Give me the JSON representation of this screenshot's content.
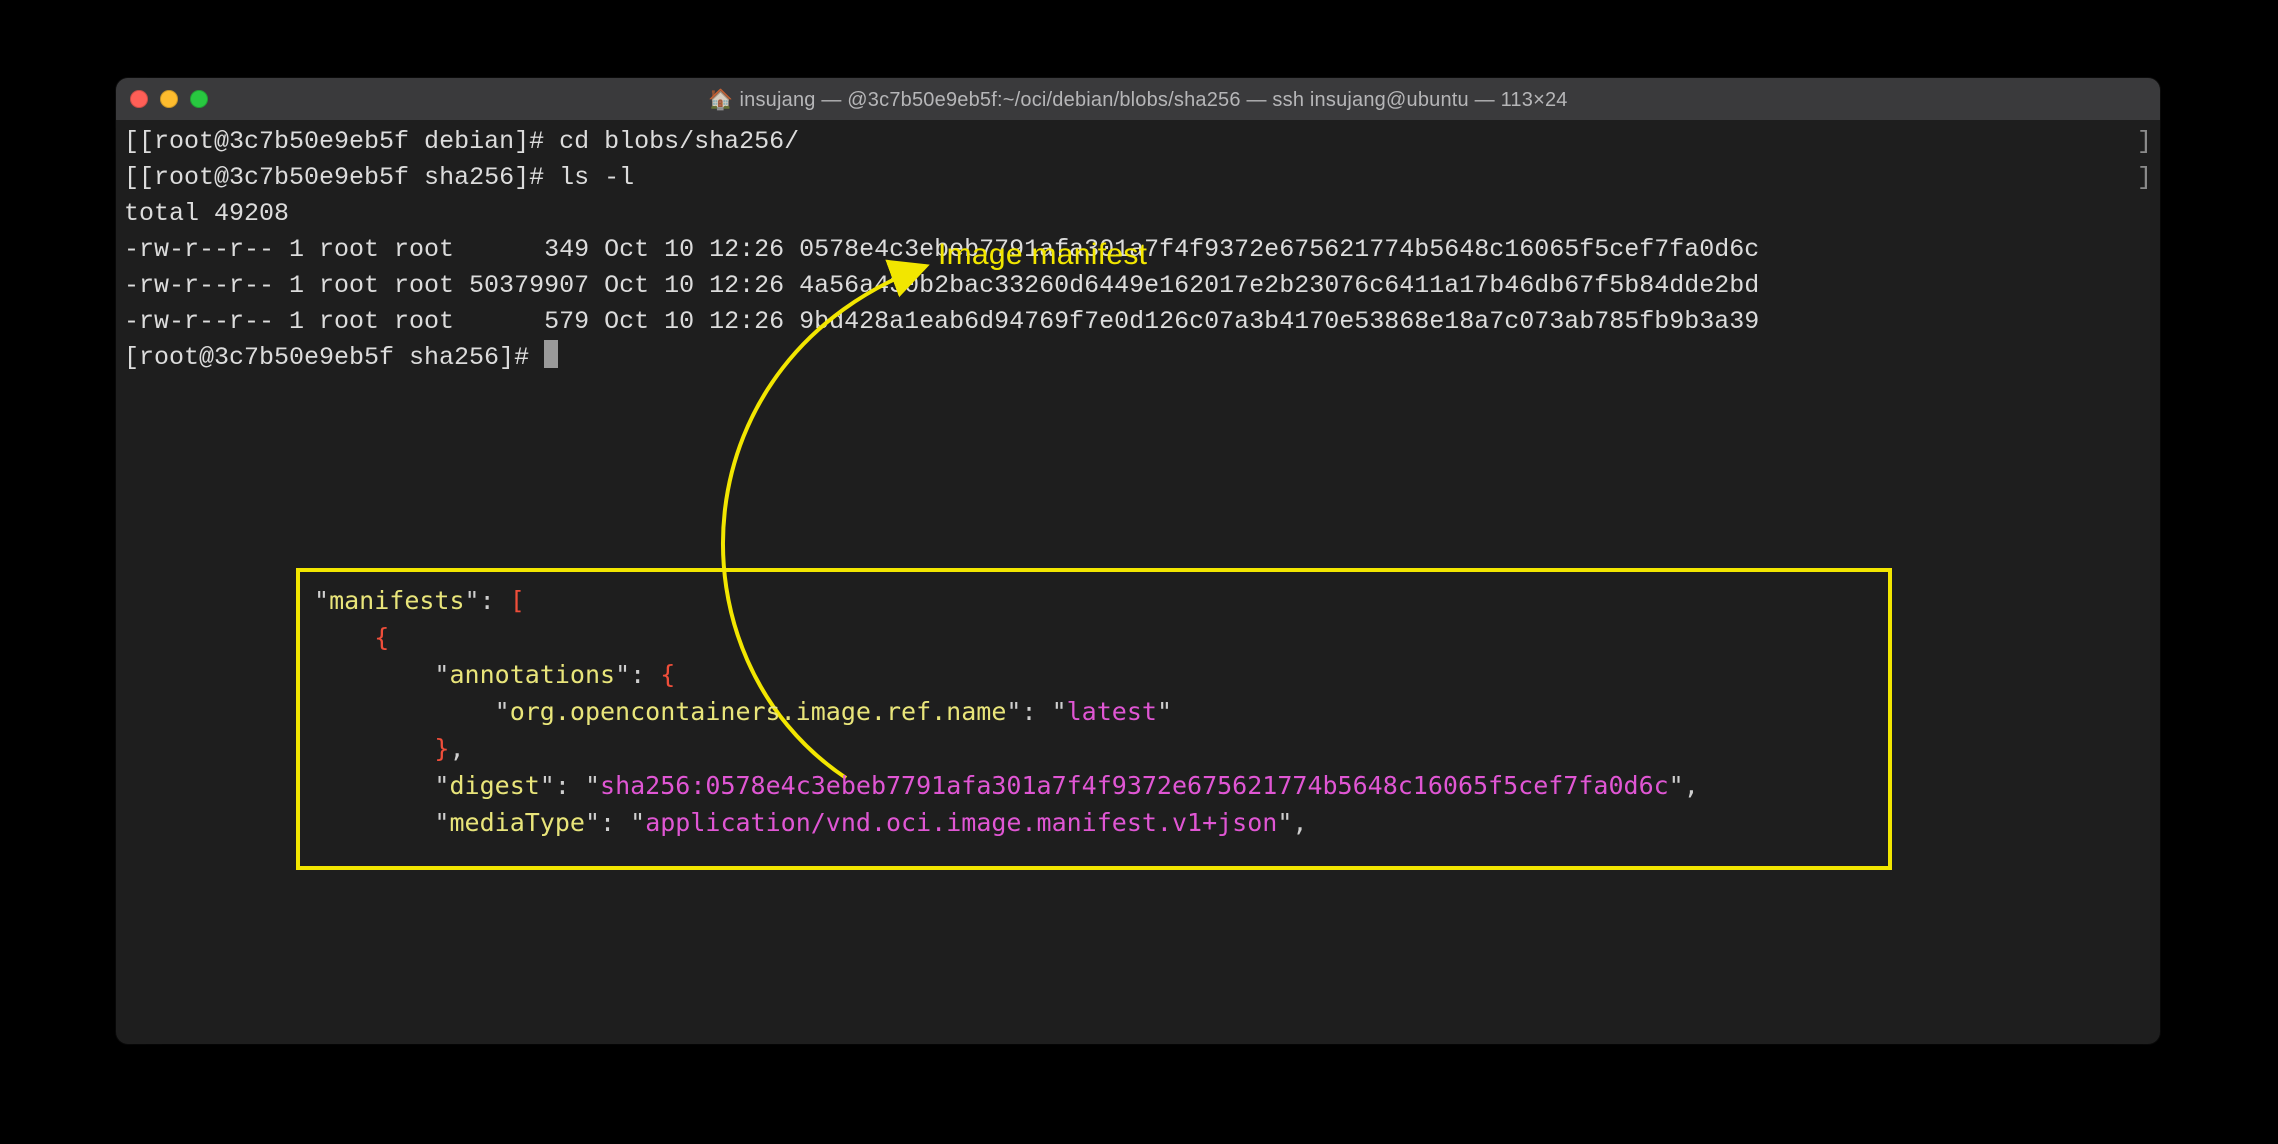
{
  "window": {
    "title": "insujang — @3c7b50e9eb5f:~/oci/debian/blobs/sha256 — ssh insujang@ubuntu — 113×24"
  },
  "terminal": {
    "prompt1": "[root@3c7b50e9eb5f debian]# ",
    "cmd1": "cd blobs/sha256/",
    "prompt2": "[root@3c7b50e9eb5f sha256]# ",
    "cmd2": "ls -l",
    "total": "total 49208",
    "row1": "-rw-r--r-- 1 root root      349 Oct 10 12:26 0578e4c3ebeb7791afa301a7f4f9372e675621774b5648c16065f5cef7fa0d6c",
    "row2": "-rw-r--r-- 1 root root 50379907 Oct 10 12:26 4a56a430b2bac33260d6449e162017e2b23076c6411a17b46db67f5b84dde2bd",
    "row3": "-rw-r--r-- 1 root root      579 Oct 10 12:26 9bd428a1eab6d94769f7e0d126c07a3b4170e53868e18a7c073ab785fb9b3a39",
    "prompt3": "[root@3c7b50e9eb5f sha256]# "
  },
  "annotation": {
    "label": "Image manifest"
  },
  "json": {
    "k_manifests": "manifests",
    "k_annotations": "annotations",
    "k_refname": "org.opencontainers.image.ref.name",
    "v_refname": "latest",
    "k_digest": "digest",
    "v_digest": "sha256:0578e4c3ebeb7791afa301a7f4f9372e675621774b5648c16065f5cef7fa0d6c",
    "k_mediatype": "mediaType",
    "v_mediatype": "application/vnd.oci.image.manifest.v1+json"
  }
}
